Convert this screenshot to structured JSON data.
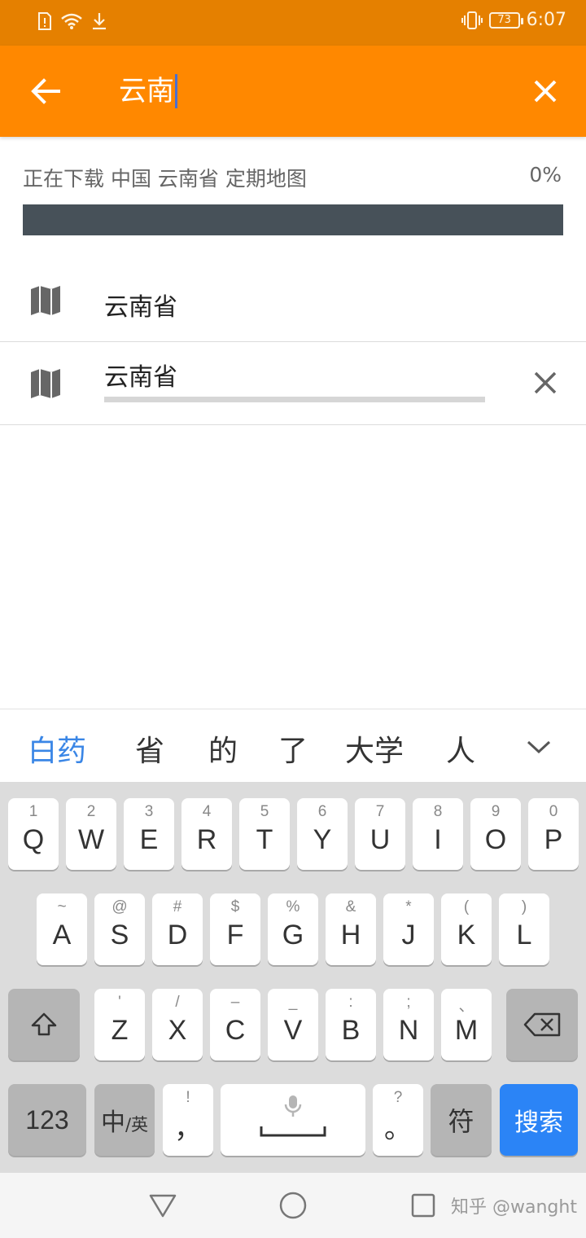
{
  "status_bar": {
    "battery": "73",
    "time": "6:07",
    "icons": [
      "sim-alert-icon",
      "wifi-icon",
      "download-icon",
      "vibrate-icon",
      "battery-icon"
    ]
  },
  "toolbar": {
    "query": "云南",
    "back_icon": "arrow-left-icon",
    "clear_icon": "close-icon"
  },
  "download": {
    "text": "正在下载 中国 云南省 定期地图",
    "percent_label": "0%",
    "progress": 0
  },
  "list": [
    {
      "label": "云南省",
      "icon": "map-icon"
    },
    {
      "label": "云南省",
      "icon": "map-icon",
      "progress": 0,
      "cancel_icon": "close-icon"
    }
  ],
  "ime": {
    "candidates": [
      "白药",
      "省",
      "的",
      "了",
      "大学",
      "人"
    ],
    "expand_icon": "chevron-down-icon"
  },
  "keyboard": {
    "row1": [
      {
        "main": "Q",
        "sub": "1"
      },
      {
        "main": "W",
        "sub": "2"
      },
      {
        "main": "E",
        "sub": "3"
      },
      {
        "main": "R",
        "sub": "4"
      },
      {
        "main": "T",
        "sub": "5"
      },
      {
        "main": "Y",
        "sub": "6"
      },
      {
        "main": "U",
        "sub": "7"
      },
      {
        "main": "I",
        "sub": "8"
      },
      {
        "main": "O",
        "sub": "9"
      },
      {
        "main": "P",
        "sub": "0"
      }
    ],
    "row2": [
      {
        "main": "A",
        "sub": "~"
      },
      {
        "main": "S",
        "sub": "@"
      },
      {
        "main": "D",
        "sub": "#"
      },
      {
        "main": "F",
        "sub": "$"
      },
      {
        "main": "G",
        "sub": "%"
      },
      {
        "main": "H",
        "sub": "&"
      },
      {
        "main": "J",
        "sub": "*"
      },
      {
        "main": "K",
        "sub": "("
      },
      {
        "main": "L",
        "sub": ")"
      }
    ],
    "row3": [
      {
        "main": "Z",
        "sub": "'"
      },
      {
        "main": "X",
        "sub": "/"
      },
      {
        "main": "C",
        "sub": "–"
      },
      {
        "main": "V",
        "sub": "_"
      },
      {
        "main": "B",
        "sub": ":"
      },
      {
        "main": "N",
        "sub": ";"
      },
      {
        "main": "M",
        "sub": "、"
      }
    ],
    "num_key": "123",
    "lang_main": "中",
    "lang_sub": "/英",
    "comma_main": "，",
    "comma_sub": "!",
    "period_main": "。",
    "period_sub": "?",
    "symbol_key": "符",
    "search_key": "搜索"
  },
  "nav": {
    "watermark": "知乎 @wanght"
  },
  "colors": {
    "status_bar": "#e58000",
    "toolbar": "#ff8800",
    "progress_track": "#475159",
    "candidate_highlight": "#3a86e6",
    "search_key": "#2b84f6"
  }
}
